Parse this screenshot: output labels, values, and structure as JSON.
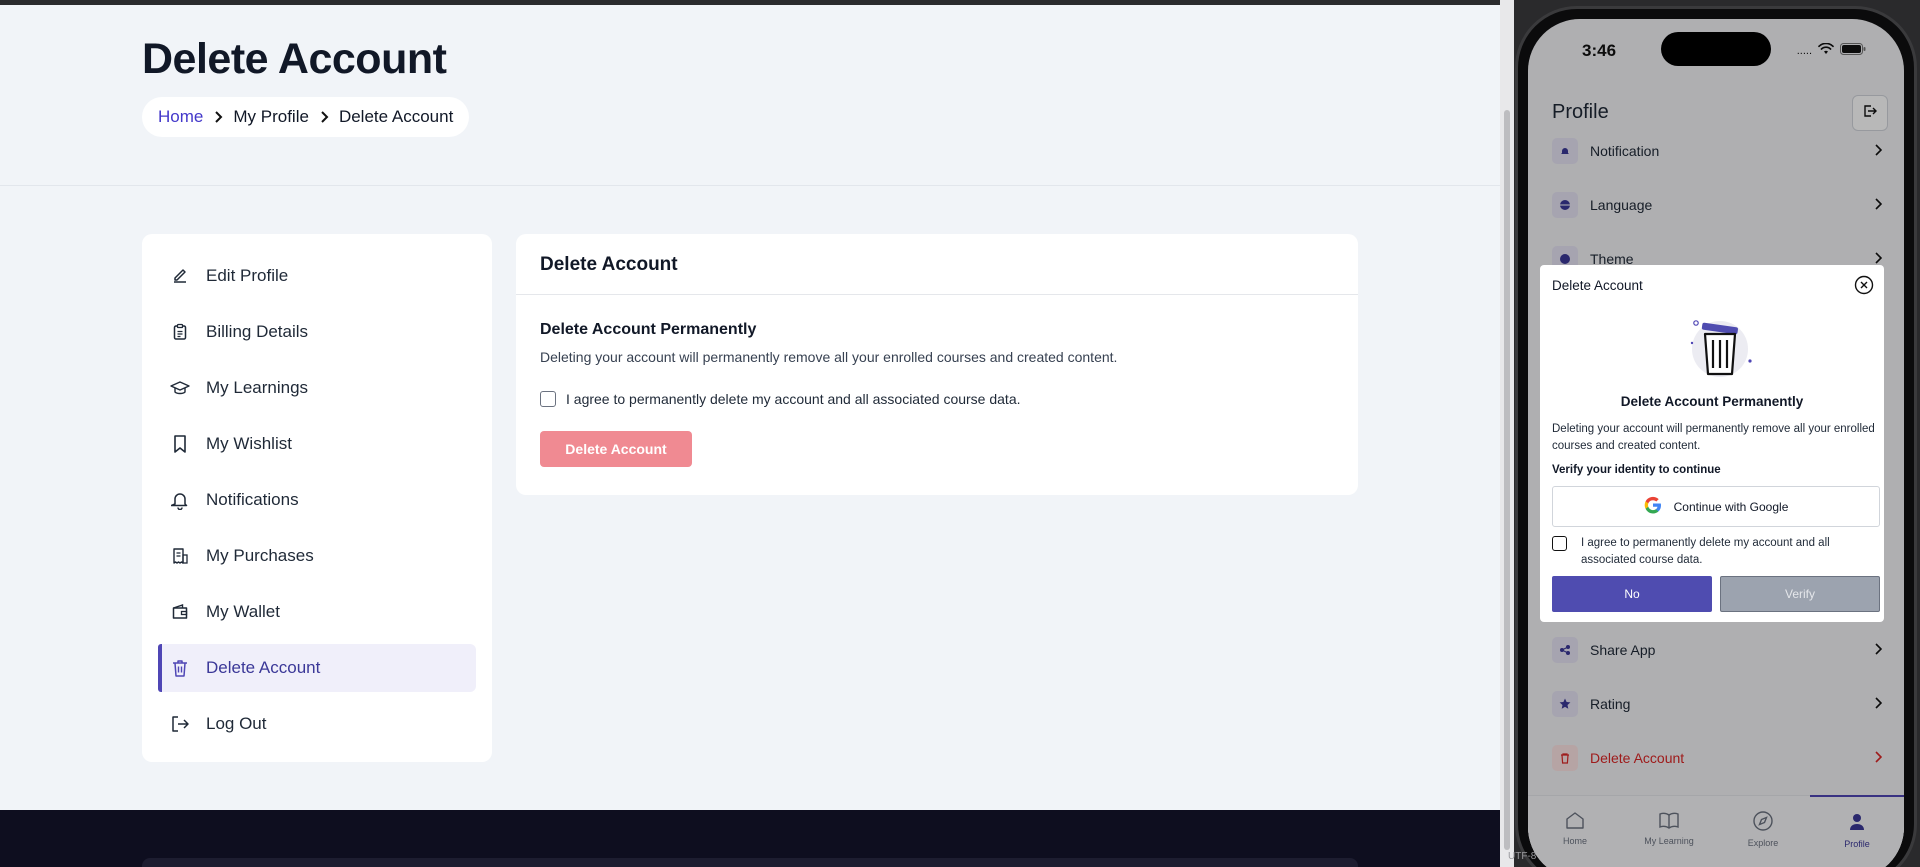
{
  "web": {
    "page_title": "Delete Account",
    "breadcrumb": [
      {
        "label": "Home"
      },
      {
        "label": "My Profile"
      },
      {
        "label": "Delete Account"
      }
    ],
    "sidebar": [
      {
        "label": "Edit Profile",
        "icon": "pencil-icon"
      },
      {
        "label": "Billing Details",
        "icon": "clipboard-icon"
      },
      {
        "label": "My Learnings",
        "icon": "graduation-cap-icon"
      },
      {
        "label": "My Wishlist",
        "icon": "bookmark-icon"
      },
      {
        "label": "Notifications",
        "icon": "bell-icon"
      },
      {
        "label": "My Purchases",
        "icon": "receipt-icon"
      },
      {
        "label": "My Wallet",
        "icon": "wallet-icon"
      },
      {
        "label": "Delete Account",
        "icon": "trash-icon",
        "active": true
      },
      {
        "label": "Log Out",
        "icon": "logout-icon"
      }
    ],
    "card": {
      "title": "Delete Account",
      "heading": "Delete Account Permanently",
      "description": "Deleting your account will permanently remove all your enrolled courses and created content.",
      "agree_label": "I agree to permanently delete my account and all associated course data.",
      "button_label": "Delete Account"
    }
  },
  "phone": {
    "status": {
      "time": "3:46",
      "signal": "....."
    },
    "header_title": "Profile",
    "menu_top": [
      {
        "label": "Notification",
        "icon": "bell-icon"
      },
      {
        "label": "Language",
        "icon": "globe-icon"
      },
      {
        "label": "Theme",
        "icon": "palette-icon"
      }
    ],
    "menu_bottom": [
      {
        "label": "Share App",
        "icon": "share-icon"
      },
      {
        "label": "Rating",
        "icon": "star-icon"
      },
      {
        "label": "Delete Account",
        "icon": "trash-icon",
        "danger": true
      }
    ],
    "tabs": [
      {
        "label": "Home",
        "icon": "home-icon"
      },
      {
        "label": "My Learning",
        "icon": "book-icon"
      },
      {
        "label": "Explore",
        "icon": "compass-icon"
      },
      {
        "label": "Profile",
        "icon": "user-icon",
        "active": true
      }
    ],
    "dialog": {
      "title": "Delete Account",
      "heading": "Delete Account Permanently",
      "description": "Deleting your account will permanently remove all your enrolled courses and created content.",
      "verify_label": "Verify your identity to continue",
      "google_label": "Continue with Google",
      "agree_label": "I agree to permanently delete my account and all associated course data.",
      "no_label": "No",
      "verify_button": "Verify"
    },
    "encoding": "UTF-8"
  },
  "colors": {
    "accent": "#4f46b5",
    "danger_button": "#f08a92",
    "page_bg": "#f1f4f8",
    "footer_bg": "#0e0e1f"
  }
}
